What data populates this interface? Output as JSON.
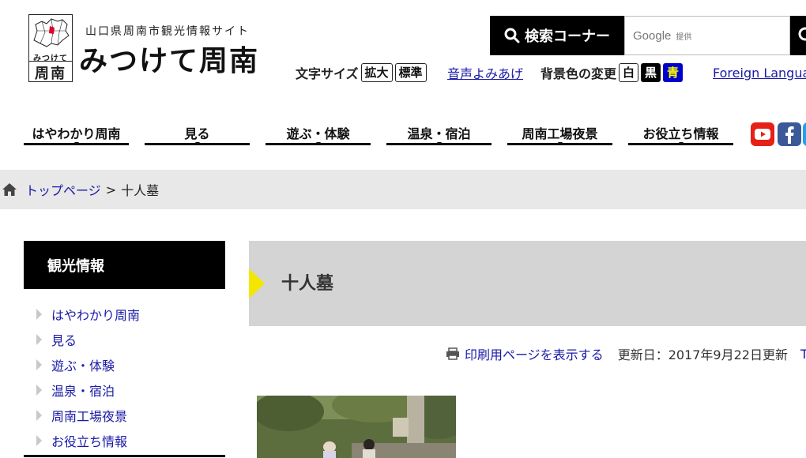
{
  "logo": {
    "subtitle": "山口県周南市観光情報サイト",
    "title": "みつけて周南",
    "mark_small": "みつけて",
    "mark_big": "周南"
  },
  "search": {
    "label": "検索コーナー",
    "google_label": "Google",
    "provided_label": "提供"
  },
  "utility": {
    "font_size_label": "文字サイズ",
    "font_size_buttons": [
      "拡大",
      "標準"
    ],
    "voice_link": "音声よみあげ",
    "bg_color_label": "背景色の変更",
    "bg_buttons": [
      "白",
      "黒",
      "青"
    ],
    "foreign_link": "Foreign Language"
  },
  "gnav": [
    "はやわかり周南",
    "見る",
    "遊ぶ・体験",
    "温泉・宿泊",
    "周南工場夜景",
    "お役立ち情報"
  ],
  "breadcrumb": {
    "home": "トップページ",
    "separator": ">",
    "current": "十人墓"
  },
  "sidebar": {
    "heading": "観光情報",
    "items": [
      "はやわかり周南",
      "見る",
      "遊ぶ・体験",
      "温泉・宿泊",
      "周南工場夜景",
      "お役立ち情報"
    ]
  },
  "main": {
    "title": "十人墓",
    "print_link": "印刷用ページを表示する",
    "updated": "更新日：2017年9月22日更新",
    "twitter_stub": "Tw"
  },
  "colors": {
    "accent_yellow": "#f5e600",
    "link_blue": "#1a1aa6",
    "youtube_red": "#e62117",
    "facebook_blue": "#3b5998"
  }
}
